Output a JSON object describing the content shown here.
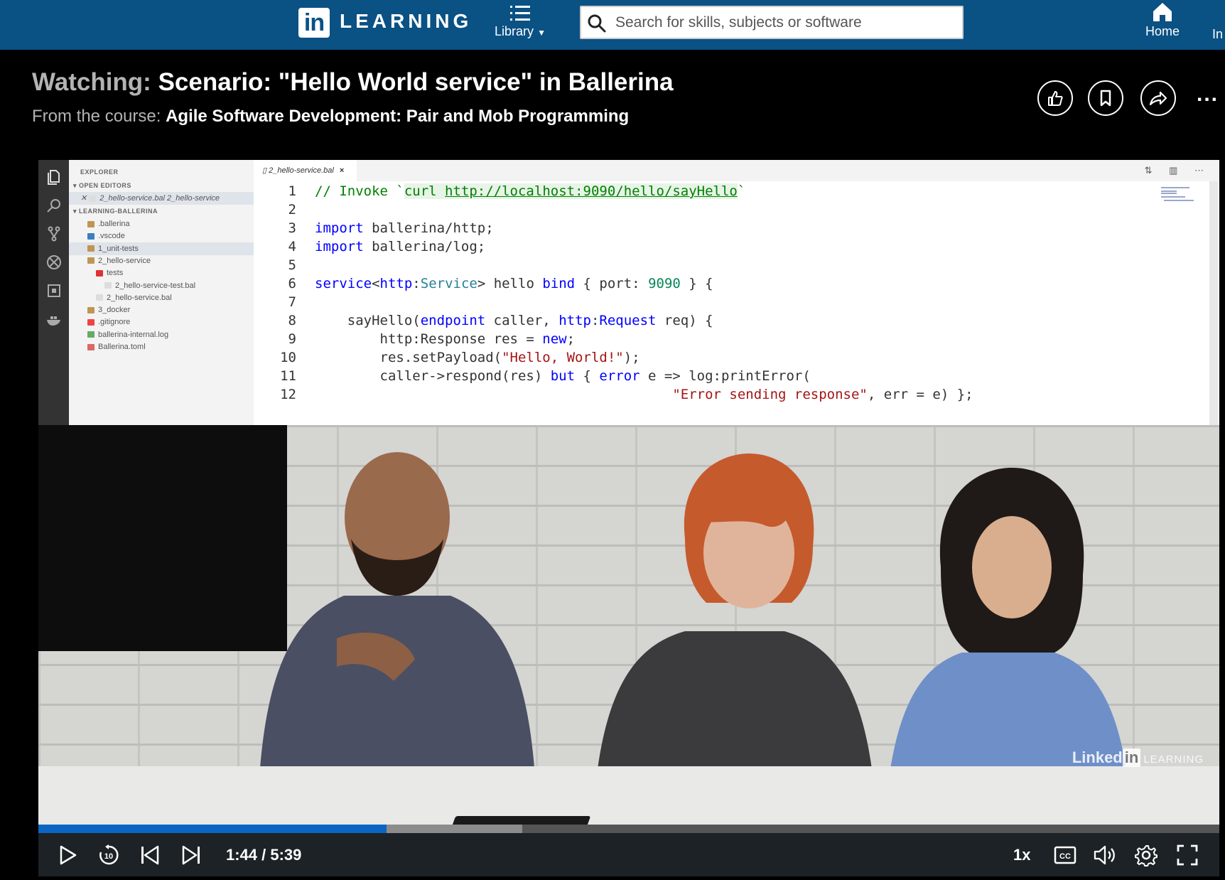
{
  "brand": {
    "logo_mark": "in",
    "logo_text": "LEARNING"
  },
  "nav": {
    "library_label": "Library",
    "search_placeholder": "Search for skills, subjects or software",
    "home_label": "Home",
    "partial_label": "In"
  },
  "video_title": {
    "watching_label": "Watching:",
    "title": "Scenario: \"Hello World service\" in Ballerina",
    "from_label": "From the course:",
    "course": "Agile Software Development: Pair and Mob Programming"
  },
  "actions": {
    "like_icon": "thumbs-up-icon",
    "save_icon": "bookmark-icon",
    "share_icon": "share-icon",
    "more_label": "..."
  },
  "editor": {
    "explorer_title": "EXPLORER",
    "open_editors_label": "OPEN EDITORS",
    "open_editor_item": "2_hello-service.bal  2_hello-service",
    "project_label": "LEARNING-BALLERINA",
    "tree": [
      {
        "label": ".ballerina",
        "indent": 1,
        "color": "#c09553"
      },
      {
        "label": ".vscode",
        "indent": 1,
        "color": "#3c7fc1"
      },
      {
        "label": "1_unit-tests",
        "indent": 1,
        "color": "#c09553"
      },
      {
        "label": "2_hello-service",
        "indent": 1,
        "color": "#c09553"
      },
      {
        "label": "tests",
        "indent": 2,
        "color": "#d33"
      },
      {
        "label": "2_hello-service-test.bal",
        "indent": 3,
        "color": "#ddd"
      },
      {
        "label": "2_hello-service.bal",
        "indent": 2,
        "color": "#ddd"
      },
      {
        "label": "3_docker",
        "indent": 1,
        "color": "#c09553"
      },
      {
        "label": ".gitignore",
        "indent": 1,
        "color": "#e44"
      },
      {
        "label": "ballerina-internal.log",
        "indent": 1,
        "color": "#6a6"
      },
      {
        "label": "Ballerina.toml",
        "indent": 1,
        "color": "#d66"
      }
    ],
    "tab_label": "2_hello-service.bal",
    "tab_close": "×",
    "line_numbers": [
      "1",
      "2",
      "3",
      "4",
      "5",
      "6",
      "7",
      "8",
      "9",
      "10",
      "11",
      "12"
    ]
  },
  "player": {
    "current_time": "1:44",
    "duration": "5:39",
    "time_display": "1:44 / 5:39",
    "progress_fraction": 0.295,
    "buffered_fraction": 0.41,
    "speed": "1x",
    "watermark_brand": "Linked",
    "watermark_in": "in",
    "watermark_learning": "LEARNING",
    "accent_color": "#0a66c2"
  }
}
